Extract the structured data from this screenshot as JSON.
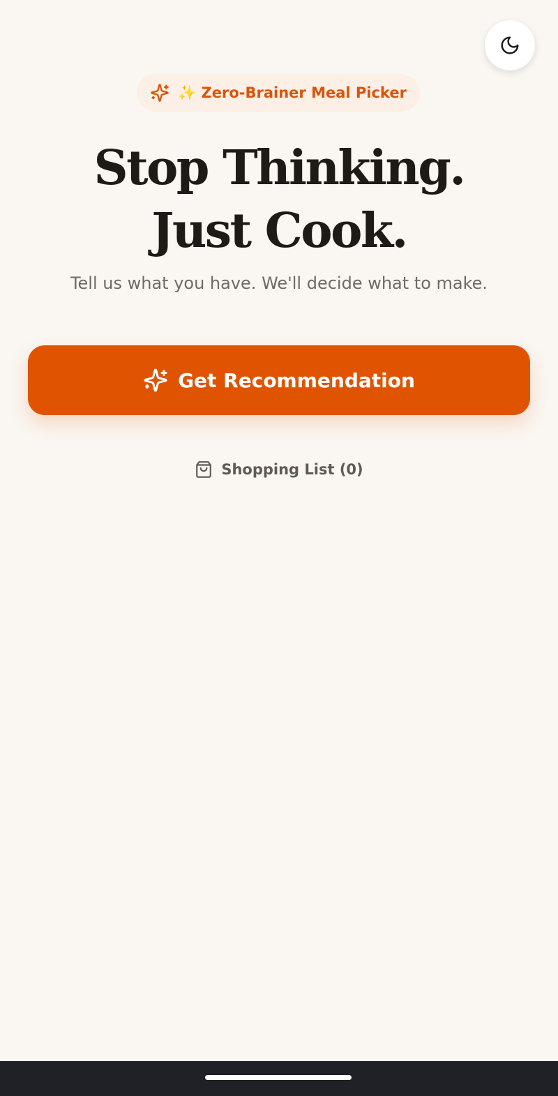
{
  "theme_toggle": {
    "icon": "moon-icon"
  },
  "badge": {
    "icon": "sparkles-icon",
    "label": "✨ Zero-Brainer Meal Picker"
  },
  "hero": {
    "title_line1": "Stop Thinking.",
    "title_line2": "Just Cook.",
    "subtitle": "Tell us what you have. We'll decide what to make."
  },
  "cta": {
    "icon": "sparkles-icon",
    "label": "Get Recommendation"
  },
  "shopping_list": {
    "icon": "shopping-bag-icon",
    "label": "Shopping List (0)"
  },
  "colors": {
    "accent": "#e05401",
    "background": "#faf6f1",
    "badge_bg": "#fcefe5",
    "heading": "#1e1b17",
    "muted_text": "#6e6a66",
    "nav_bar": "#202127"
  }
}
